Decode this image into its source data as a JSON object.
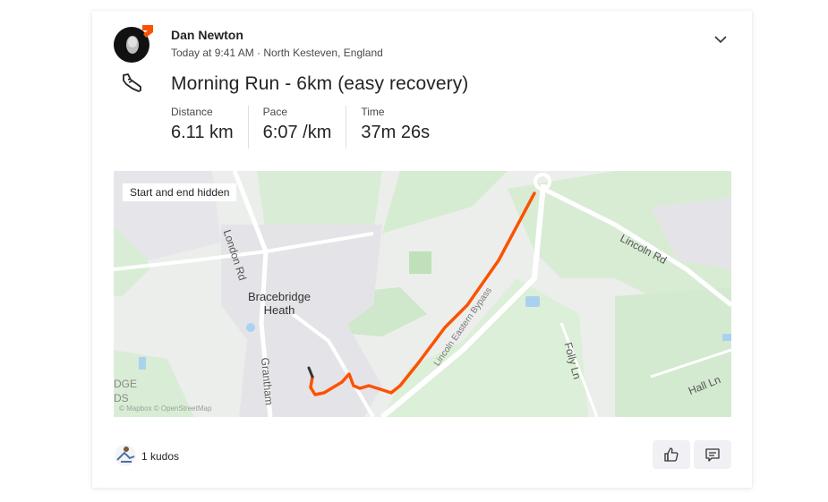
{
  "athlete": {
    "name": "Dan Newton",
    "meta": "Today at 9:41 AM · North Kesteven, England"
  },
  "activity": {
    "title": "Morning Run - 6km (easy recovery)",
    "stats": [
      {
        "label": "Distance",
        "value": "6.11 km"
      },
      {
        "label": "Pace",
        "value": "6:07 /km"
      },
      {
        "label": "Time",
        "value": "37m 26s"
      }
    ]
  },
  "map": {
    "badge": "Start and end hidden",
    "labels": {
      "town_line1": "Bracebridge",
      "town_line2": "Heath",
      "london_rd": "London Rd",
      "grantham": "Grantham",
      "lincoln_rd": "Lincoln Rd",
      "bypass": "Lincoln Eastern Bypass",
      "folly_ln": "Folly Ln",
      "hall_ln": "Hall Ln",
      "edge": "DGE\nDS"
    },
    "attribution": "© Mapbox © OpenStreetMap",
    "route_color": "#fc5200"
  },
  "footer": {
    "kudos_label": "1 kudos"
  },
  "colors": {
    "brand": "#fc5200",
    "text": "#242428"
  }
}
